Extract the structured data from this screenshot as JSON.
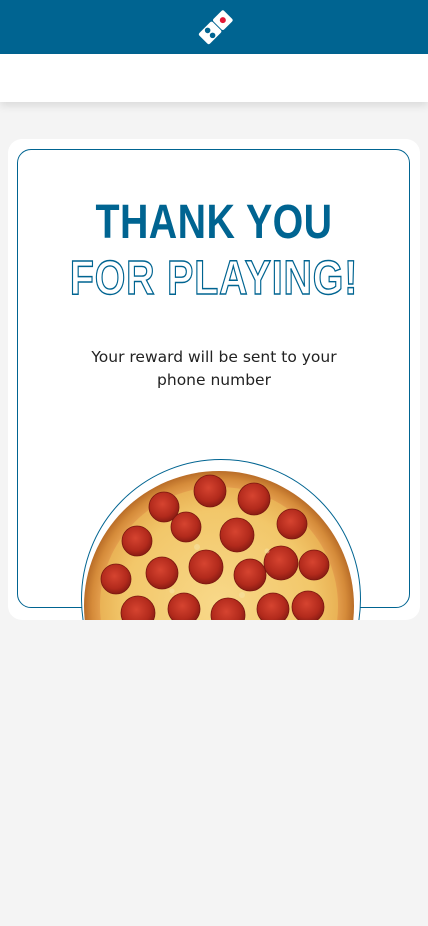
{
  "brand": {
    "logo_icon": "dominos-domino-logo-icon",
    "primary_color": "#006491"
  },
  "card": {
    "headline_line1": "THANK YOU",
    "headline_line2": "FOR PLAYING!",
    "message": "Your reward will be sent to your phone number",
    "image_icon": "pepperoni-pizza-image"
  }
}
